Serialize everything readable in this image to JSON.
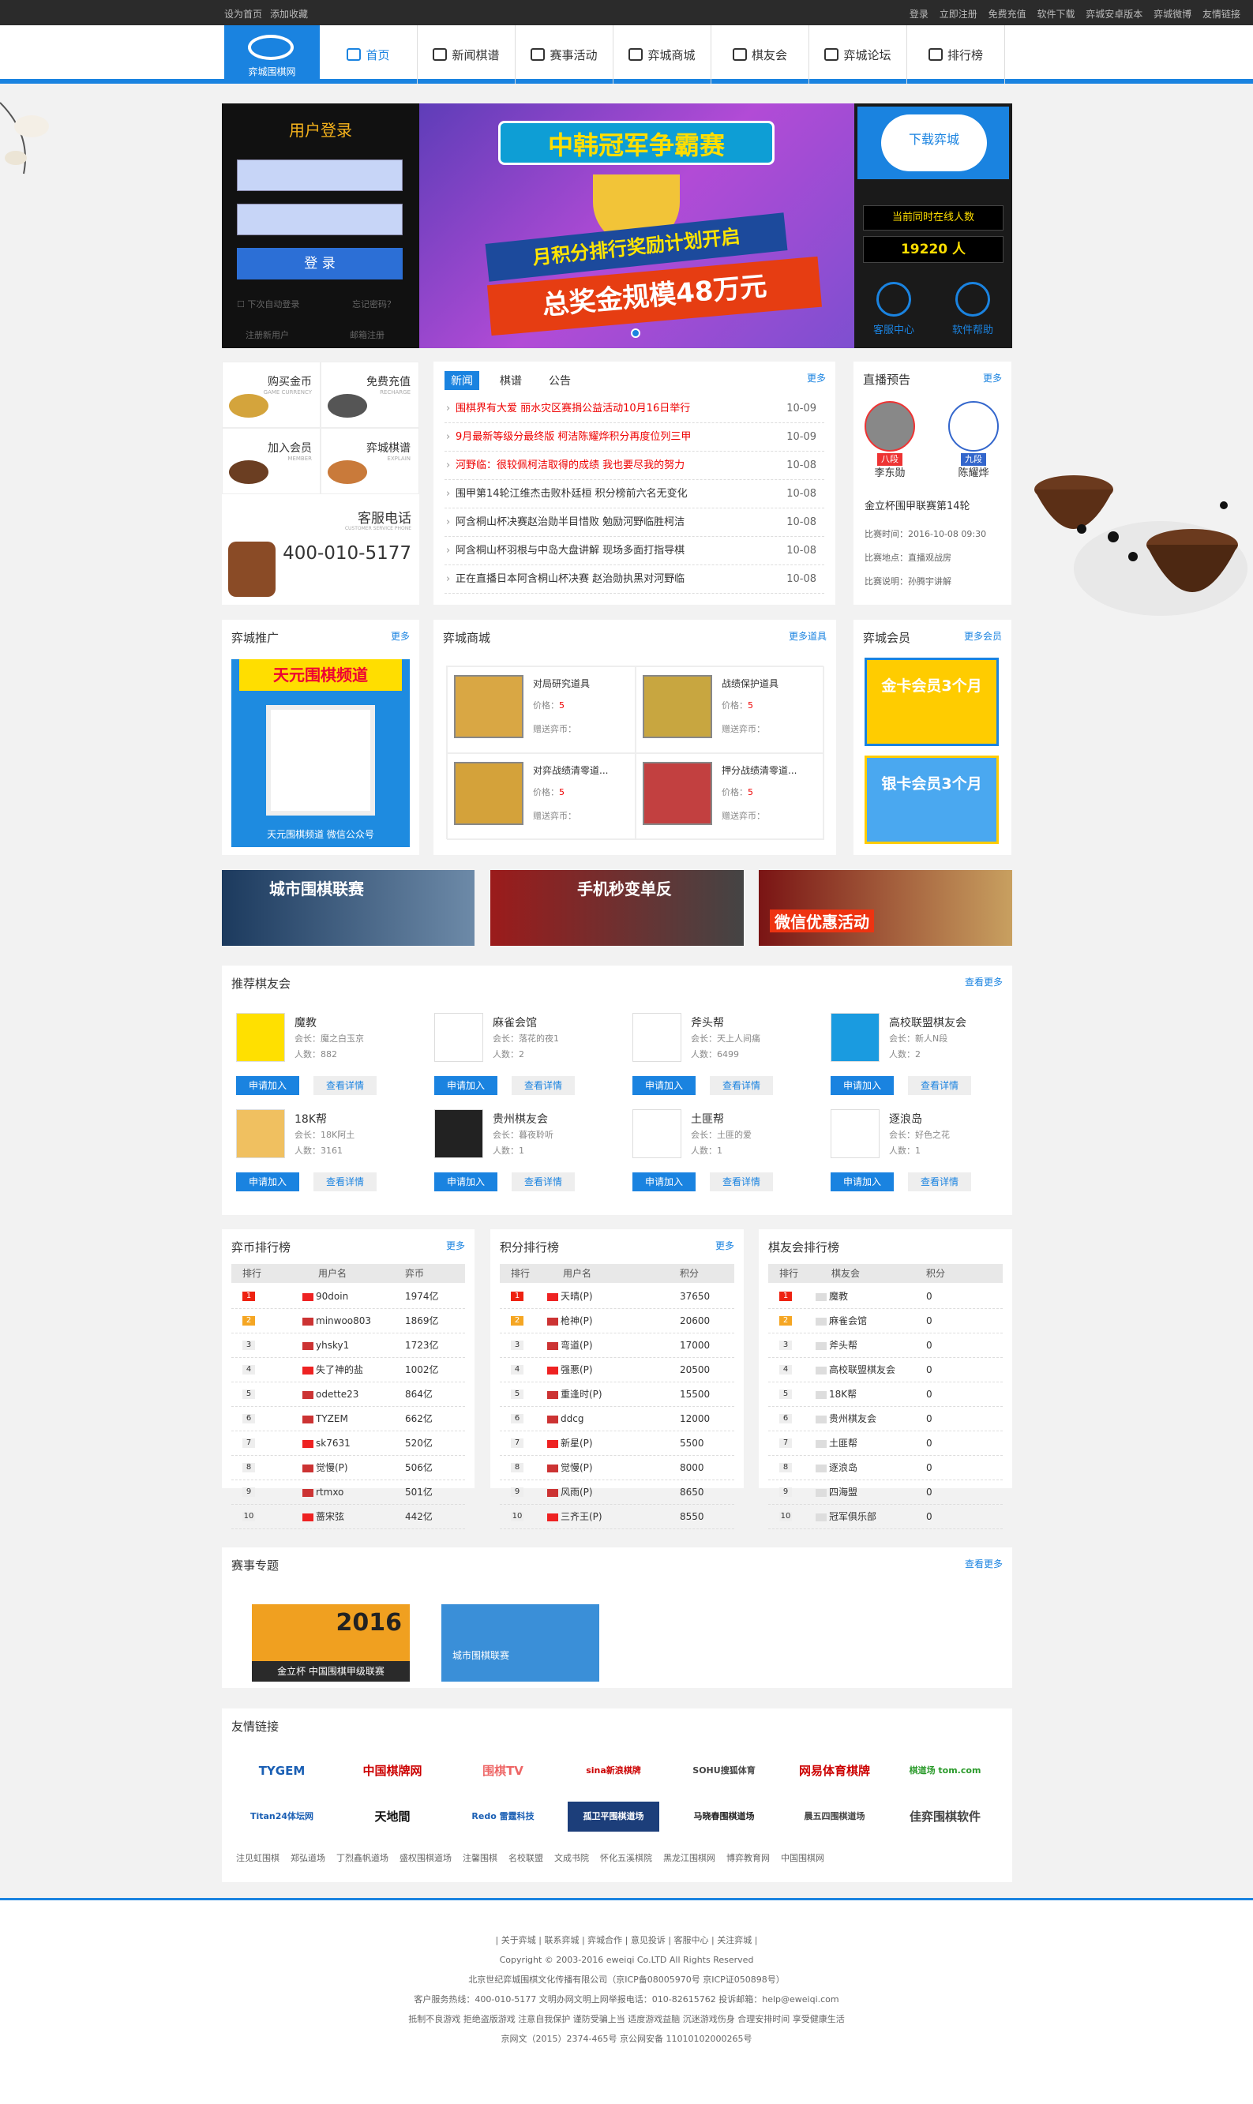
{
  "topbar": {
    "left": [
      "设为首页",
      "添加收藏"
    ],
    "right": [
      "登录",
      "立即注册",
      "免费充值",
      "软件下载",
      "弈城安卓版本",
      "弈城微博",
      "友情链接"
    ]
  },
  "logo": {
    "text": "弈城围棋网"
  },
  "nav": [
    "首页",
    "新闻棋谱",
    "赛事活动",
    "弈城商城",
    "棋友会",
    "弈城论坛",
    "排行榜"
  ],
  "login": {
    "title": "用户登录",
    "button": "登 录",
    "remember": "下次自动登录",
    "forgot": "忘记密码？",
    "register": "注册新用户",
    "mailreg": "邮箱注册"
  },
  "banner": {
    "title": "中韩冠军争霸赛",
    "line2": "月积分排行奖励计划开启",
    "line3": "总奖金规模48万元"
  },
  "right": {
    "download": "下载弈城",
    "online_label": "当前同时在线人数",
    "online_count": "19220 人",
    "service": "客服中心",
    "help": "软件帮助"
  },
  "quick": {
    "items": [
      {
        "cn": "购买金币",
        "en": "GAME CURRENCY"
      },
      {
        "cn": "免费充值",
        "en": "RECHARGE"
      },
      {
        "cn": "加入会员",
        "en": "MEMBER"
      },
      {
        "cn": "弈城棋谱",
        "en": "EXPLAIN"
      }
    ],
    "phone_label": "客服电话",
    "phone_en": "CUSTOMER SERVICE PHONE",
    "phone": "400-010-5177"
  },
  "news": {
    "tabs": [
      "新闻",
      "棋谱",
      "公告"
    ],
    "more": "更多",
    "items": [
      {
        "t": "围棋界有大爱 丽水灾区赛捐公益活动10月16日举行",
        "d": "10-09",
        "red": true
      },
      {
        "t": "9月最新等级分最终版 柯洁陈耀烨积分再度位列三甲",
        "d": "10-09",
        "red": true
      },
      {
        "t": "河野临：很较佩柯洁取得的成绩 我也要尽我的努力",
        "d": "10-08",
        "red": true
      },
      {
        "t": "围甲第14轮江维杰击败朴廷桓 积分榜前六名无变化",
        "d": "10-08",
        "red": false
      },
      {
        "t": "阿含桐山杯决赛赵治勋半目惜败 勉励河野临胜柯洁",
        "d": "10-08",
        "red": false
      },
      {
        "t": "阿含桐山杯羽根与中岛大盘讲解 现场多面打指导棋",
        "d": "10-08",
        "red": false
      },
      {
        "t": "正在直播日本阿含桐山杯决赛 赵治勋执黑对河野临",
        "d": "10-08",
        "red": false
      }
    ]
  },
  "live": {
    "title": "直播预告",
    "more": "更多",
    "p1": "李东勋",
    "p2": "陈耀烨",
    "r1": "八段",
    "r2": "九段",
    "match": "金立杯围甲联赛第14轮",
    "time": "比赛时间：2016-10-08 09:30",
    "place": "比赛地点：直播观战房",
    "note": "比赛说明：孙腾宇讲解"
  },
  "promo": {
    "title": "弈城推广",
    "more": "更多",
    "banner": "天元围棋频道",
    "foot": "天元围棋频道 微信公众号"
  },
  "mall": {
    "title": "弈城商城",
    "more": "更多道具",
    "items": [
      {
        "n": "对局研究道具",
        "price": "5",
        "gift": "赠送弈币："
      },
      {
        "n": "战绩保护道具",
        "price": "5",
        "gift": "赠送弈币："
      },
      {
        "n": "对弈战绩清零道...",
        "price": "5",
        "gift": "赠送弈币："
      },
      {
        "n": "押分战绩清零道...",
        "price": "5",
        "gift": "赠送弈币："
      }
    ],
    "price_label": "价格：",
    "currency": ""
  },
  "vip": {
    "title": "弈城会员",
    "more": "更多会员",
    "gold": "金卡会员3个月",
    "silver": "银卡会员3个月"
  },
  "ads": [
    "城市围棋联赛",
    "手机秒变单反",
    "微信优惠活动"
  ],
  "clubs": {
    "title": "推荐棋友会",
    "more": "查看更多",
    "apply": "申请加入",
    "detail": "查看详情",
    "items": [
      {
        "n": "魔教",
        "leader": "会长：魔之白玉京",
        "count": "人数：882"
      },
      {
        "n": "麻雀会馆",
        "leader": "会长：落花的夜1",
        "count": "人数：2"
      },
      {
        "n": "斧头帮",
        "leader": "会长：天上人间痛",
        "count": "人数：6499"
      },
      {
        "n": "高校联盟棋友会",
        "leader": "会长：新人N段",
        "count": "人数：2"
      },
      {
        "n": "18K帮",
        "leader": "会长：18K阿土",
        "count": "人数：3161"
      },
      {
        "n": "贵州棋友会",
        "leader": "会长：暮夜聆听",
        "count": "人数：1"
      },
      {
        "n": "土匪帮",
        "leader": "会长：土匪的爱",
        "count": "人数：1"
      },
      {
        "n": "逐浪岛",
        "leader": "会长：好色之花",
        "count": "人数：1"
      }
    ]
  },
  "rank1": {
    "title": "弈币排行榜",
    "more": "更多",
    "cols": [
      "排行",
      "用户名",
      "弈币"
    ],
    "rows": [
      [
        "1",
        "90doin",
        "1974亿"
      ],
      [
        "2",
        "minwoo803",
        "1869亿"
      ],
      [
        "3",
        "yhsky1",
        "1723亿"
      ],
      [
        "4",
        "失了神的盐",
        "1002亿"
      ],
      [
        "5",
        "odette23",
        "864亿"
      ],
      [
        "6",
        "TYZEM",
        "662亿"
      ],
      [
        "7",
        "sk7631",
        "520亿"
      ],
      [
        "8",
        "觉慢(P)",
        "506亿"
      ],
      [
        "9",
        "rtmxo",
        "501亿"
      ],
      [
        "10",
        "蔷宋弦",
        "442亿"
      ]
    ]
  },
  "rank2": {
    "title": "积分排行榜",
    "more": "更多",
    "cols": [
      "排行",
      "用户名",
      "积分"
    ],
    "rows": [
      [
        "1",
        "天晴(P)",
        "37650"
      ],
      [
        "2",
        "枪神(P)",
        "20600"
      ],
      [
        "3",
        "弯道(P)",
        "17000"
      ],
      [
        "4",
        "强悪(P)",
        "20500"
      ],
      [
        "5",
        "重逢时(P)",
        "15500"
      ],
      [
        "6",
        "ddcg",
        "12000"
      ],
      [
        "7",
        "新星(P)",
        "5500"
      ],
      [
        "8",
        "觉慢(P)",
        "8000"
      ],
      [
        "9",
        "风雨(P)",
        "8650"
      ],
      [
        "10",
        "三齐王(P)",
        "8550"
      ]
    ]
  },
  "rank3": {
    "title": "棋友会排行榜",
    "cols": [
      "排行",
      "棋友会",
      "积分"
    ],
    "rows": [
      [
        "1",
        "魔教",
        "0"
      ],
      [
        "2",
        "麻雀会馆",
        "0"
      ],
      [
        "3",
        "斧头帮",
        "0"
      ],
      [
        "4",
        "高校联盟棋友会",
        "0"
      ],
      [
        "5",
        "18K帮",
        "0"
      ],
      [
        "6",
        "贵州棋友会",
        "0"
      ],
      [
        "7",
        "土匪帮",
        "0"
      ],
      [
        "8",
        "逐浪岛",
        "0"
      ],
      [
        "9",
        "四海盟",
        "0"
      ],
      [
        "10",
        "冠军俱乐部",
        "0"
      ]
    ]
  },
  "topics": {
    "title": "赛事专题",
    "more": "查看更多",
    "t1": "2016",
    "t1b": "金立杯 中国围棋甲级联赛",
    "t2": "城市围棋联赛"
  },
  "links": {
    "title": "友情链接",
    "logos": [
      "TYGEM",
      "中国棋牌网",
      "围棋TV",
      "sina新浪棋牌",
      "SOHU搜狐体育",
      "网易体育棋牌",
      "棋道场 tom.com",
      "Titan24体坛网",
      "天地間",
      "Redo 雷霆科技",
      "孤卫平围棋道场",
      "马晓春围棋道场",
      "晨五四围棋道场",
      "佳弈围棋软件"
    ],
    "text": [
      "注见虹围棋",
      "郑弘道场",
      "丁烈鑫帆道场",
      "盛权围棋道场",
      "注馨围棋",
      "名校联盟",
      "文成书院",
      "怀化五溪棋院",
      "黑龙江围棋网",
      "博弈教育网",
      "中国围棋网"
    ]
  },
  "footer": {
    "l1": "| 关于弈城 | 联系弈城 | 弈城合作 | 意见投诉 | 客服中心 | 关注弈城 |",
    "l2": "Copyright © 2003-2016 eweiqi Co.LTD All Rights Reserved",
    "l3": "北京世纪弈城围棋文化传播有限公司（京ICP备08005970号 京ICP证050898号）",
    "l4": "客户服务热线：400-010-5177 文明办网文明上网举报电话：010-82615762 投诉邮箱：help@eweiqi.com",
    "l5": "抵制不良游戏 拒绝盗版游戏 注意自我保护 谨防受骗上当 适度游戏益脑 沉迷游戏伤身 合理安排时间 享受健康生活",
    "l6": "京网文（2015）2374-465号 京公网安备 11010102000265号"
  }
}
